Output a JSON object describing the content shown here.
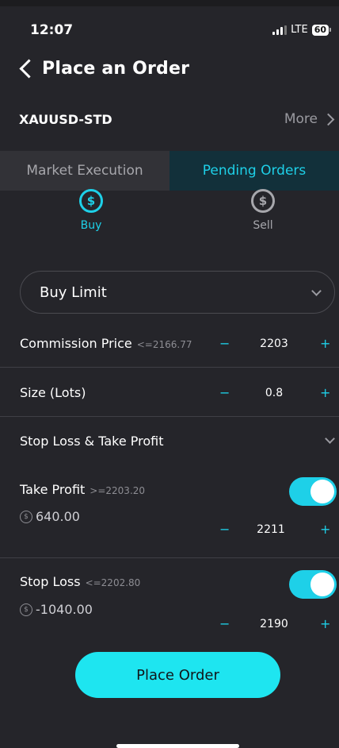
{
  "status": {
    "time": "12:07",
    "network": "LTE",
    "battery": "60"
  },
  "header": {
    "title": "Place an Order"
  },
  "symbol": {
    "name": "XAUUSD-STD",
    "more_label": "More"
  },
  "tabs": [
    {
      "label": "Market Execution",
      "active": false
    },
    {
      "label": "Pending Orders",
      "active": true
    }
  ],
  "sides": {
    "buy_label": "Buy",
    "sell_label": "Sell",
    "icon_glyph": "$"
  },
  "order_type": {
    "selected": "Buy Limit"
  },
  "commission_price": {
    "label": "Commission Price",
    "hint": "<=2166.77",
    "value": "2203",
    "minus": "−",
    "plus": "+"
  },
  "size": {
    "label": "Size (Lots)",
    "value": "0.8",
    "minus": "−",
    "plus": "+"
  },
  "sltp": {
    "label": "Stop Loss & Take Profit"
  },
  "take_profit": {
    "label": "Take Profit",
    "hint": ">=2203.20",
    "pl": "640.00",
    "value": "2211",
    "enabled": true,
    "minus": "−",
    "plus": "+"
  },
  "stop_loss": {
    "label": "Stop Loss",
    "hint": "<=2202.80",
    "pl": "-1040.00",
    "value": "2190",
    "enabled": true,
    "minus": "−",
    "plus": "+"
  },
  "submit": {
    "label": "Place Order"
  },
  "colors": {
    "accent": "#1ed0e8",
    "background": "#25252a",
    "button": "#1ee5f0"
  }
}
